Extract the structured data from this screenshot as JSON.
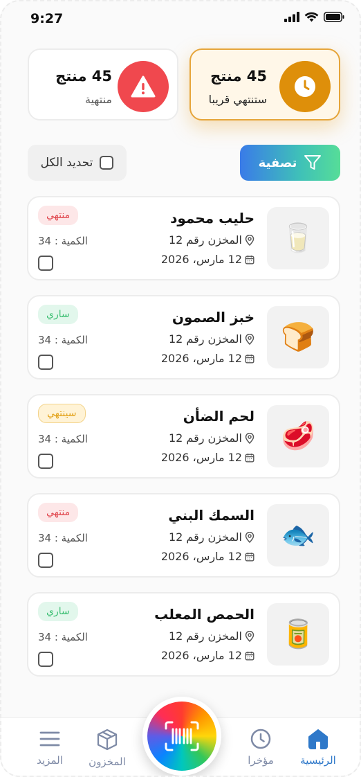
{
  "status_bar": {
    "time": "9:27"
  },
  "summary": {
    "soon": {
      "count": "45 منتج",
      "label": "ستنتهي قريبا",
      "accent": "#de8f0a"
    },
    "expired": {
      "count": "45 منتج",
      "label": "منتهية",
      "accent": "#f0484e"
    }
  },
  "toolbar": {
    "filter_label": "تصفية",
    "select_all_label": "تحديد الكل"
  },
  "products": [
    {
      "name": "حليب محمود",
      "location": "المخزن رقم 12",
      "date": "12 مارس، 2026",
      "status": "منتهي",
      "quantity": "الكمية : 34",
      "emoji": "🥛"
    },
    {
      "name": "خبز الصمون",
      "location": "المخزن رقم 12",
      "date": "12 مارس، 2026",
      "status": "ساري",
      "quantity": "الكمية : 34",
      "emoji": "🍞"
    },
    {
      "name": "لحم الضأن",
      "location": "المخزن رقم 12",
      "date": "12 مارس، 2026",
      "status": "سينتهي",
      "quantity": "الكمية : 34",
      "emoji": "🥩"
    },
    {
      "name": "السمك البني",
      "location": "المخزن رقم 12",
      "date": "12 مارس، 2026",
      "status": "منتهي",
      "quantity": "الكمية : 34",
      "emoji": "🐟"
    },
    {
      "name": "الحمص المعلب",
      "location": "المخزن رقم 12",
      "date": "12 مارس، 2026",
      "status": "ساري",
      "quantity": "الكمية : 34",
      "emoji": "🥫"
    }
  ],
  "nav": {
    "home": "الرئيسية",
    "recent": "مؤخرا",
    "inventory": "المخزون",
    "more": "المزيد"
  },
  "colors": {
    "active_nav": "#2e78c9",
    "inactive_nav": "#7e8aa6",
    "expired": "#e0454c",
    "valid": "#3cbf73",
    "expiring": "#e2a21a"
  }
}
